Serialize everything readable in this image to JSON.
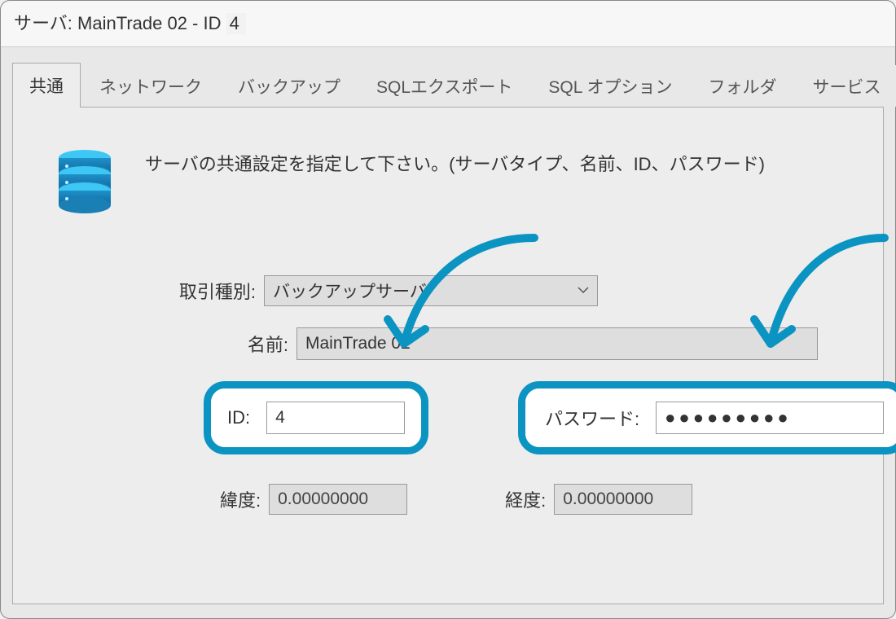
{
  "titlebar": {
    "prefix": "サーバ: ",
    "server_name": "MainTrade 02",
    "sep": " - ID ",
    "server_id": "4"
  },
  "tabs": [
    {
      "label": "共通",
      "active": true
    },
    {
      "label": "ネットワーク",
      "active": false
    },
    {
      "label": "バックアップ",
      "active": false
    },
    {
      "label": "SQLエクスポート",
      "active": false
    },
    {
      "label": "SQL オプション",
      "active": false
    },
    {
      "label": "フォルダ",
      "active": false
    },
    {
      "label": "サービス",
      "active": false
    }
  ],
  "panel": {
    "description": "サーバの共通設定を指定して下さい。(サーバタイプ、名前、ID、パスワード)"
  },
  "form": {
    "trade_type_label": "取引種別:",
    "trade_type_value": "バックアップサーバ",
    "name_label": "名前:",
    "name_value": "MainTrade 02",
    "id_label": "ID:",
    "id_value": "4",
    "password_label": "パスワード:",
    "password_value": "●●●●●●●●●",
    "latitude_label": "緯度:",
    "latitude_value": "0.00000000",
    "longitude_label": "経度:",
    "longitude_value": "0.00000000"
  },
  "icon": {
    "server_icon": "server-icon",
    "chevron": "chevron-down-icon"
  },
  "colors": {
    "highlight": "#0b94c2",
    "panel_bg": "#ededed",
    "input_bg": "#dedede"
  }
}
